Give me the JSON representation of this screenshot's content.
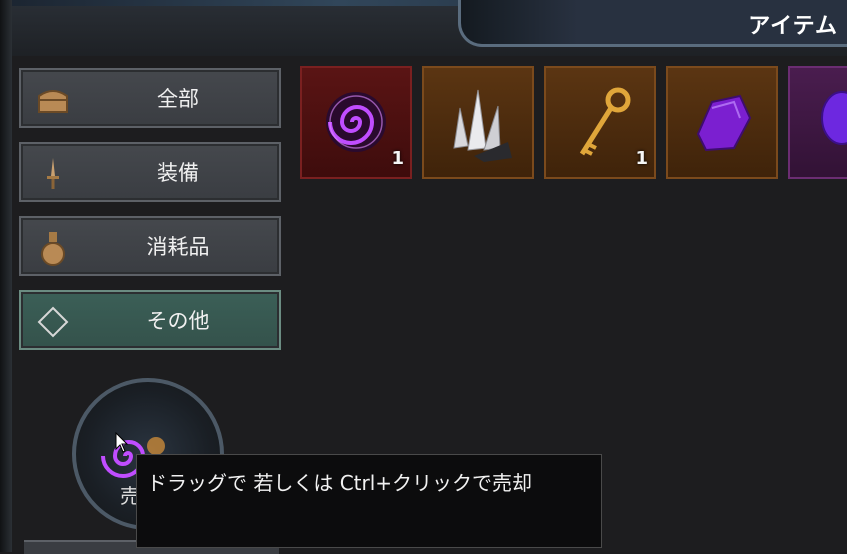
{
  "window": {
    "title": "アイテム"
  },
  "categories": [
    {
      "label": "全部",
      "icon": "chest-icon",
      "active": false
    },
    {
      "label": "装備",
      "icon": "dagger-icon",
      "active": false
    },
    {
      "label": "消耗品",
      "icon": "potion-icon",
      "active": false
    },
    {
      "label": "その他",
      "icon": "diamond-icon",
      "active": true
    }
  ],
  "inventory": [
    {
      "icon": "spiral-orb-icon",
      "rarity": "red",
      "count": "1"
    },
    {
      "icon": "crystal-cluster-icon",
      "rarity": "orange",
      "count": ""
    },
    {
      "icon": "golden-key-icon",
      "rarity": "orange",
      "count": "1"
    },
    {
      "icon": "purple-gem-icon",
      "rarity": "orange",
      "count": ""
    },
    {
      "icon": "purple-orb-icon",
      "rarity": "purple",
      "count": ""
    }
  ],
  "sell_zone": {
    "label": "売"
  },
  "tooltip": {
    "text": "ドラッグで 若しくは Ctrl+クリックで売却"
  },
  "colors": {
    "rarity_red": "#5a1414",
    "rarity_orange": "#5b3512",
    "rarity_purple": "#4a1d4f",
    "active_category": "#3b5f57"
  }
}
